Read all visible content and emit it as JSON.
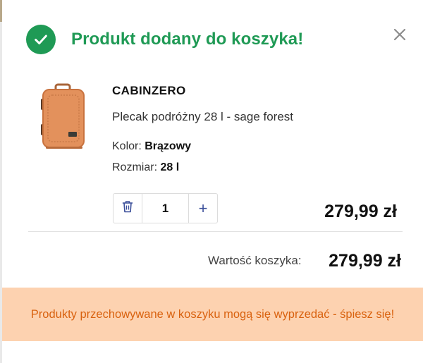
{
  "modal": {
    "title": "Produkt dodany do koszyka!",
    "accent_color": "#1f9a55",
    "icons": {
      "success": "check-circle-icon",
      "close": "close-icon"
    }
  },
  "product": {
    "brand": "CABINZERO",
    "name": "Plecak podróżny 28 l - sage forest",
    "color_label": "Kolor:",
    "color_value": "Brązowy",
    "size_label": "Rozmiar:",
    "size_value": "28 l",
    "quantity": "1",
    "price": "279,99 zł",
    "image": "orange-backpack"
  },
  "controls": {
    "remove_icon": "trash-icon",
    "increase_icon": "plus-icon"
  },
  "cart": {
    "total_label": "Wartość koszyka:",
    "total_value": "279,99 zł"
  },
  "warning": {
    "text": "Produkty przechowywane w koszyku mogą się wyprzedać - śpiesz się!",
    "text_color": "#d9620f",
    "background": "#fdd2b0"
  }
}
